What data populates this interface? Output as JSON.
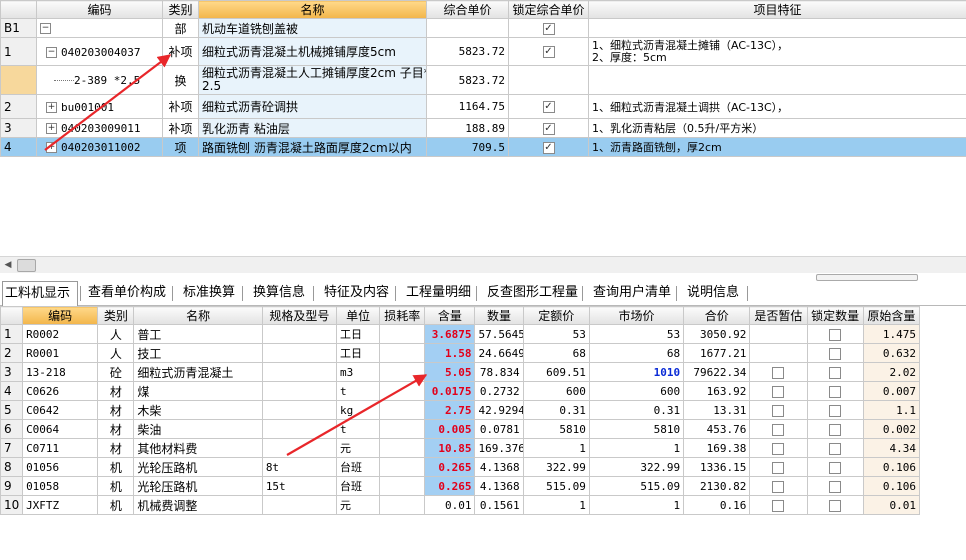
{
  "top": {
    "headers": [
      "",
      "编码",
      "类别",
      "名称",
      "综合单价",
      "锁定综合单价",
      "项目特征"
    ],
    "rows": [
      {
        "num": "B1",
        "tree": "−",
        "code": "",
        "type": "部",
        "name": "机动车道铣刨盖被",
        "price": "",
        "locked": true,
        "feature": ""
      },
      {
        "num": "1",
        "tree": "−",
        "code": "040203004037",
        "type": "补项",
        "name": "细粒式沥青混凝土机械摊铺厚度5cm",
        "price": "5823.72",
        "locked": true,
        "feature": "1、细粒式沥青混凝土摊铺（AC-13C），",
        "feature2": "2、厚度：5cm"
      },
      {
        "num": "",
        "tree": "",
        "code": "2-389 *2.5",
        "type": "换",
        "name": "细粒式沥青混凝土人工摊铺厚度2cm 子目*",
        "name2": "2.5",
        "price": "5823.72",
        "locked": false,
        "feature": ""
      },
      {
        "num": "2",
        "tree": "+",
        "code": "bu001001",
        "type": "补项",
        "name": "细粒式沥青砼调拱",
        "price": "1164.75",
        "locked": true,
        "feature": "1、细粒式沥青混凝土调拱（AC-13C），"
      },
      {
        "num": "3",
        "tree": "+",
        "code": "040203009011",
        "type": "补项",
        "name": "乳化沥青 粘油层",
        "price": "188.89",
        "locked": true,
        "feature": "1、乳化沥青粘层（0.5升/平方米）"
      },
      {
        "num": "4",
        "tree": "+",
        "code": "040203011002",
        "type": "项",
        "name": "路面铣刨 沥青混凝土路面厚度2cm以内",
        "price": "709.5",
        "locked": true,
        "feature": "1、沥青路面铣刨，厚2cm"
      }
    ]
  },
  "tabs": [
    "工料机显示",
    "查看单价构成",
    "标准换算",
    "换算信息",
    "特征及内容",
    "工程量明细",
    "反查图形工程量",
    "查询用户清单",
    "说明信息"
  ],
  "bottom": {
    "headers": [
      "",
      "编码",
      "类别",
      "名称",
      "规格及型号",
      "单位",
      "损耗率",
      "含量",
      "数量",
      "定额价",
      "市场价",
      "合价",
      "是否暂估",
      "锁定数量",
      "原始含量"
    ],
    "rows": [
      {
        "num": "1",
        "code": "R0002",
        "type": "人",
        "name": "普工",
        "spec": "",
        "unit": "工日",
        "loss": "",
        "content": "3.6875",
        "qty": "57.5645",
        "quota": "53",
        "market": "53",
        "total": "3050.92",
        "est": false,
        "lock": true,
        "orig": "1.475"
      },
      {
        "num": "2",
        "code": "R0001",
        "type": "人",
        "name": "技工",
        "spec": "",
        "unit": "工日",
        "loss": "",
        "content": "1.58",
        "qty": "24.6649",
        "quota": "68",
        "market": "68",
        "total": "1677.21",
        "est": false,
        "lock": true,
        "orig": "0.632"
      },
      {
        "num": "3",
        "code": "13-218",
        "type": "砼",
        "name": "细粒式沥青混凝土",
        "spec": "",
        "unit": "m3",
        "loss": "",
        "content": "5.05",
        "qty": "78.834",
        "quota": "609.51",
        "market": "1010",
        "total": "79622.34",
        "est": true,
        "lock": true,
        "orig": "2.02"
      },
      {
        "num": "4",
        "code": "C0626",
        "type": "材",
        "name": "煤",
        "spec": "",
        "unit": "t",
        "loss": "",
        "content": "0.0175",
        "qty": "0.2732",
        "quota": "600",
        "market": "600",
        "total": "163.92",
        "est": true,
        "lock": true,
        "orig": "0.007"
      },
      {
        "num": "5",
        "code": "C0642",
        "type": "材",
        "name": "木柴",
        "spec": "",
        "unit": "kg",
        "loss": "",
        "content": "2.75",
        "qty": "42.9294",
        "quota": "0.31",
        "market": "0.31",
        "total": "13.31",
        "est": true,
        "lock": true,
        "orig": "1.1"
      },
      {
        "num": "6",
        "code": "C0064",
        "type": "材",
        "name": "柴油",
        "spec": "",
        "unit": "t",
        "loss": "",
        "content": "0.005",
        "qty": "0.0781",
        "quota": "5810",
        "market": "5810",
        "total": "453.76",
        "est": true,
        "lock": true,
        "orig": "0.002"
      },
      {
        "num": "7",
        "code": "C0711",
        "type": "材",
        "name": "其他材料费",
        "spec": "",
        "unit": "元",
        "loss": "",
        "content": "10.85",
        "qty": "169.376",
        "quota": "1",
        "market": "1",
        "total": "169.38",
        "est": true,
        "lock": true,
        "orig": "4.34"
      },
      {
        "num": "8",
        "code": "01056",
        "type": "机",
        "name": "光轮压路机",
        "spec": "8t",
        "unit": "台班",
        "loss": "",
        "content": "0.265",
        "qty": "4.1368",
        "quota": "322.99",
        "market": "322.99",
        "total": "1336.15",
        "est": true,
        "lock": true,
        "orig": "0.106"
      },
      {
        "num": "9",
        "code": "01058",
        "type": "机",
        "name": "光轮压路机",
        "spec": "15t",
        "unit": "台班",
        "loss": "",
        "content": "0.265",
        "qty": "4.1368",
        "quota": "515.09",
        "market": "515.09",
        "total": "2130.82",
        "est": true,
        "lock": true,
        "orig": "0.106"
      },
      {
        "num": "10",
        "code": "JXFTZ",
        "type": "机",
        "name": "机械费调整",
        "spec": "",
        "unit": "元",
        "loss": "",
        "content": "0.01",
        "qty": "0.1561",
        "quota": "1",
        "market": "1",
        "total": "0.16",
        "est": true,
        "lock": true,
        "orig": "0.01"
      }
    ]
  },
  "colors": {
    "arrow": "#e8262a",
    "highlight": "#a3cff3",
    "selected_row": "#99ccf0",
    "header_accent": "#f2b54a"
  }
}
